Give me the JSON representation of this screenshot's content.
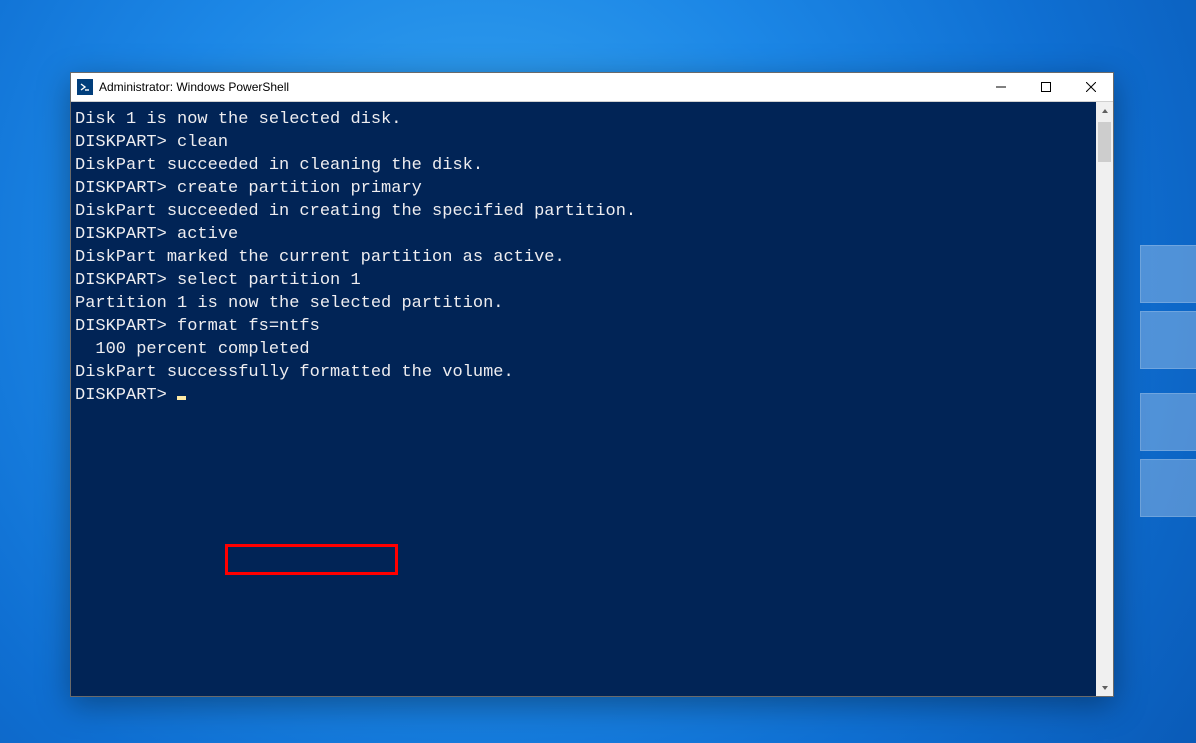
{
  "window": {
    "title": "Administrator: Windows PowerShell"
  },
  "terminal": {
    "lines": [
      "Disk 1 is now the selected disk.",
      "",
      "DISKPART> clean",
      "",
      "DiskPart succeeded in cleaning the disk.",
      "",
      "DISKPART> create partition primary",
      "",
      "DiskPart succeeded in creating the specified partition.",
      "",
      "DISKPART> active",
      "",
      "DiskPart marked the current partition as active.",
      "",
      "DISKPART> select partition 1",
      "",
      "Partition 1 is now the selected partition.",
      "",
      "DISKPART> format fs=ntfs",
      "",
      "  100 percent completed",
      "",
      "DiskPart successfully formatted the volume.",
      "",
      "DISKPART> "
    ],
    "highlighted_command": "format fs=ntfs"
  }
}
